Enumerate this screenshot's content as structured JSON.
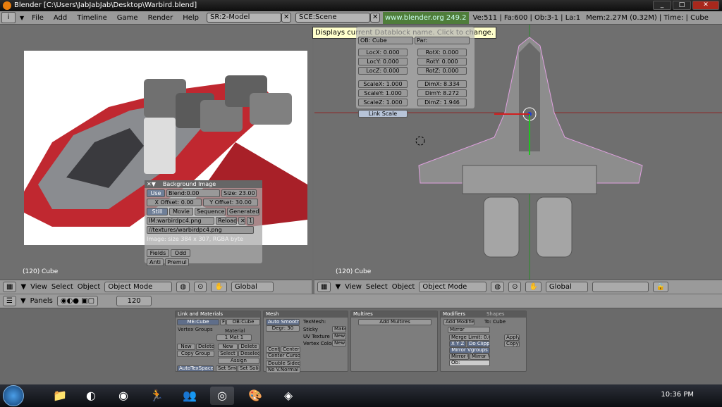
{
  "window": {
    "title": "Blender [C:\\Users\\JabJabJab\\Desktop\\Warbird.blend]",
    "min": "_",
    "max": "□",
    "close": "✕"
  },
  "menu": {
    "items": [
      "File",
      "Add",
      "Timeline",
      "Game",
      "Render",
      "Help"
    ],
    "screen": "SR:2-Model",
    "scene": "SCE:Scene",
    "url": "www.blender.org 249.2",
    "stats": "Ve:511 | Fa:600 | Ob:3-1 | La:1",
    "mem": "Mem:2.27M (0.32M) | Time: | Cube"
  },
  "tooltip": "Displays current Datablock name. Click to change.",
  "bgimage": {
    "title": "Background Image",
    "use": "Use",
    "blend": "Blend:0.00",
    "size": "Size: 23.00",
    "xoff": "X Offset: 0.00",
    "yoff": "Y Offset: 30.00",
    "tabs": [
      "Still",
      "Movie",
      "Sequence",
      "Generated"
    ],
    "im": "IM:warbirdpc4.png",
    "reload": "Reload",
    "x": "✕",
    "one": "1",
    "path": "//textures/warbirdpc4.png",
    "info": "Image: size 384 x 307, RGBA byte",
    "fields": "Fields",
    "odd": "Odd",
    "anti": "Anti",
    "premul": "Premul"
  },
  "transform": {
    "ob": "OB: Cube",
    "par": "Par:",
    "loc": [
      "LocX: 0.000",
      "LocY: 0.000",
      "LocZ: 0.000"
    ],
    "rot": [
      "RotX: 0.000",
      "RotY: 0.000",
      "RotZ: 0.000"
    ],
    "scale": [
      "ScaleX: 1.000",
      "ScaleY: 1.000",
      "ScaleZ: 1.000"
    ],
    "dim": [
      "DimX: 8.334",
      "DimY: 8.272",
      "DimZ: 1.946"
    ],
    "link": "Link Scale"
  },
  "viewport": {
    "left_label": "(120) Cube",
    "right_label": "(120) Cube"
  },
  "vheader": {
    "view": "View",
    "select": "Select",
    "object": "Object",
    "mode": "Object Mode",
    "orient": "Global"
  },
  "buttons": {
    "panels": "Panels",
    "frame": "120",
    "link": {
      "title": "Link and Materials",
      "me": "ME:Cube",
      "f": "F",
      "obc": "OB:Cube",
      "vg": "Vertex Groups",
      "material": "Material",
      "mat": "1 Mat 1",
      "new": "New",
      "delete": "Delete",
      "copy": "Copy Group",
      "select": "Select",
      "deselect": "Deselect",
      "assign": "Assign",
      "autotex": "AutoTexSpace",
      "setsmoo": "Set Smoo",
      "setsolid": "Set Solid"
    },
    "mesh": {
      "title": "Mesh",
      "autosmooth": "Auto Smooth",
      "degr": "Degr: 30",
      "texmesh": "TexMesh:",
      "sticky": "Sticky",
      "make": "Make",
      "uvtex": "UV Texture",
      "new": "New",
      "vcol": "Vertex Color",
      "new2": "New",
      "centre": "Centre",
      "centrenew": "Center New",
      "centercursor": "Center Cursor",
      "double": "Double Sided",
      "nov": "No V.Normal Flip"
    },
    "multires": {
      "title": "Multires",
      "add": "Add Multires"
    },
    "modifiers": {
      "title": "Modifiers",
      "shapes": "Shapes",
      "addmod": "Add Modifier",
      "to": "To: Cube",
      "mirror": "Mirror",
      "merge": "Merge Limit: 0.0010",
      "xyz": "X Y Z",
      "doclip": "Do Clipping",
      "mirrorvg": "Mirror Vgroups",
      "mirroru": "Mirror U",
      "mirrorv": "Mirror V",
      "ob": "Ob:",
      "apply": "Apply",
      "copy": "Copy"
    }
  },
  "taskbar": {
    "clock": "10:36 PM"
  }
}
